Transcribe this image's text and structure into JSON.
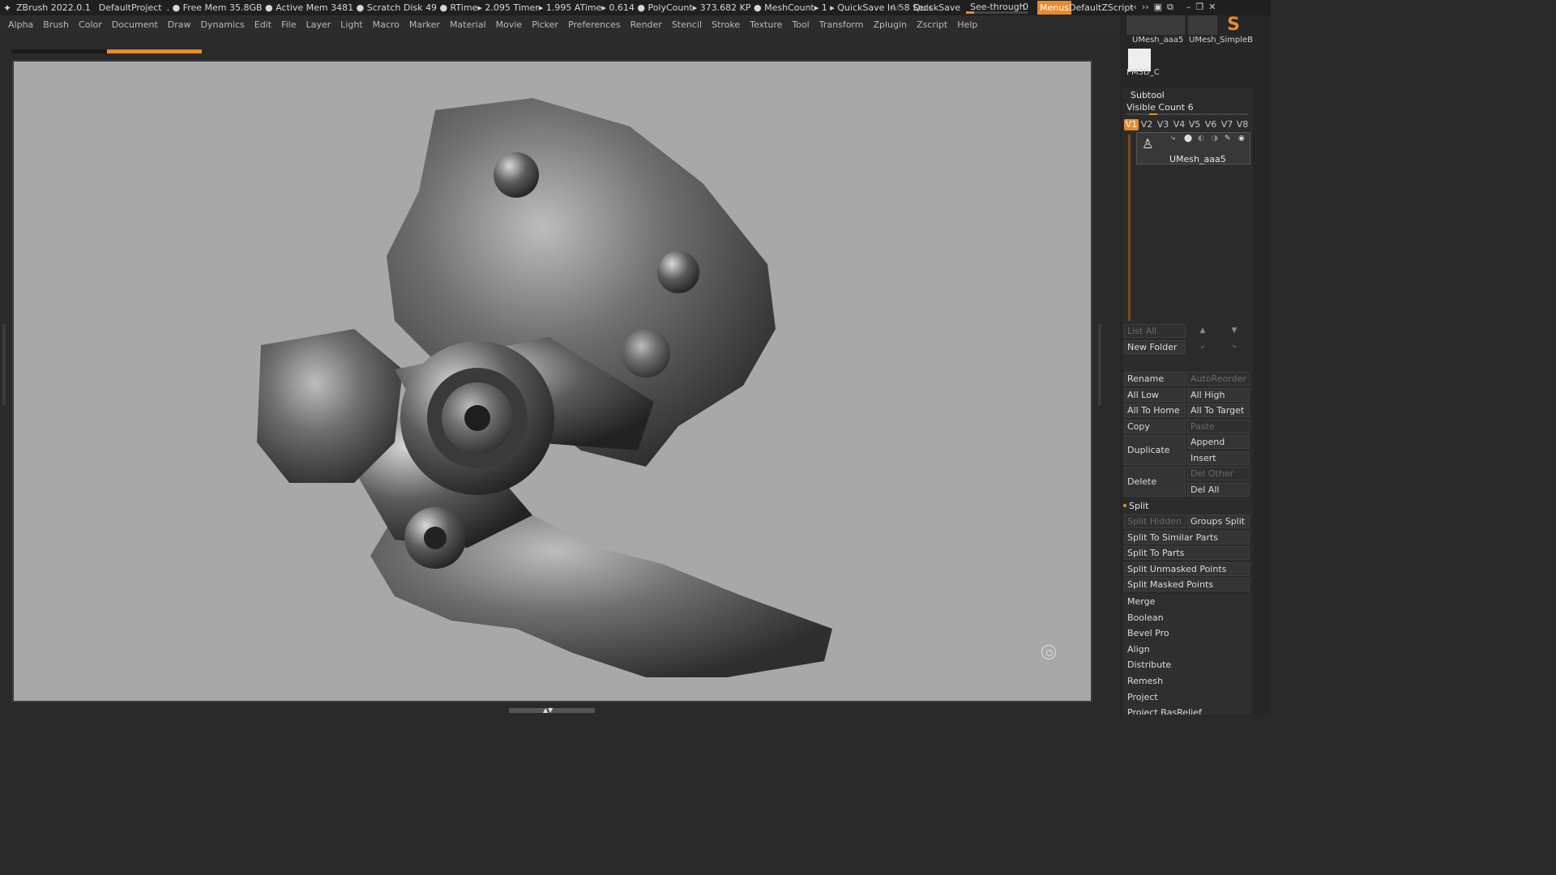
{
  "status": {
    "app": "ZBrush 2022.0.1",
    "project": "DefaultProject",
    "stats": ". ● Free Mem 35.8GB ● Active Mem 3481 ● Scratch Disk 49 ●  RTime▸ 2.095 Timer▸ 1.995 ATime▸ 0.614 ● PolyCount▸ 373.682 KP  ● MeshCount▸ 1  ▸ QuickSave In 58 Secs",
    "ac": "AC",
    "quicksave": "QuickSave",
    "see_through_label": "See-through",
    "see_through_value": "0",
    "menus": "Menus",
    "script": "DefaultZScript"
  },
  "menu": [
    "Alpha",
    "Brush",
    "Color",
    "Document",
    "Draw",
    "Dynamics",
    "Edit",
    "File",
    "Layer",
    "Light",
    "Macro",
    "Marker",
    "Material",
    "Movie",
    "Picker",
    "Preferences",
    "Render",
    "Stencil",
    "Stroke",
    "Texture",
    "Tool",
    "Transform",
    "Zplugin",
    "Zscript",
    "Help"
  ],
  "tool_thumbs": {
    "t1": "UMesh_aaa5",
    "t2": "UMesh_",
    "t3": "SimpleB",
    "t4": "PM3D_C"
  },
  "subtool": {
    "title": "Subtool",
    "visible_count": "Visible Count 6",
    "tabs": [
      "V1",
      "V2",
      "V3",
      "V4",
      "V5",
      "V6",
      "V7",
      "V8"
    ],
    "item_name": "UMesh_aaa5"
  },
  "buttons": {
    "list_all": "List All",
    "new_folder": "New Folder",
    "rename": "Rename",
    "auto_reorder": "AutoReorder",
    "all_low": "All Low",
    "all_high": "All High",
    "all_to_home": "All To Home",
    "all_to_target": "All To Target",
    "copy": "Copy",
    "paste": "Paste",
    "duplicate": "Duplicate",
    "append": "Append",
    "insert": "Insert",
    "delete": "Delete",
    "del_other": "Del Other",
    "del_all": "Del All",
    "split": "Split",
    "split_hidden": "Split Hidden",
    "groups_split": "Groups Split",
    "split_similar": "Split To Similar Parts",
    "split_parts": "Split To Parts",
    "split_unmasked": "Split Unmasked Points",
    "split_masked": "Split Masked Points",
    "merge": "Merge",
    "boolean": "Boolean",
    "bevel_pro": "Bevel Pro",
    "align": "Align",
    "distribute": "Distribute",
    "remesh": "Remesh",
    "project": "Project",
    "project_basrelief": "Project BasRelief"
  }
}
